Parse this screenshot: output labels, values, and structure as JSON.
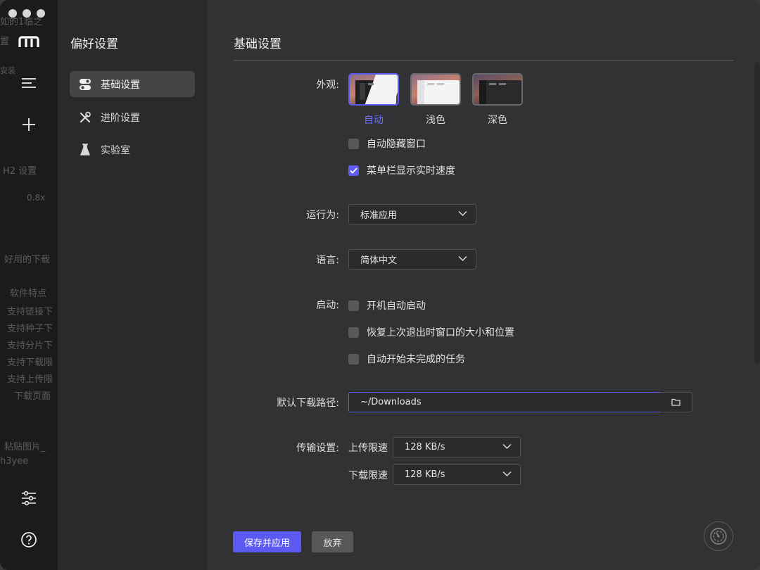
{
  "sidebar": {
    "title": "偏好设置",
    "items": [
      {
        "label": "基础设置",
        "active": true
      },
      {
        "label": "进阶设置",
        "active": false
      },
      {
        "label": "实验室",
        "active": false
      }
    ]
  },
  "main": {
    "title": "基础设置",
    "appearance": {
      "label": "外观:",
      "themes": [
        {
          "name": "自动",
          "selected": true
        },
        {
          "name": "浅色",
          "selected": false
        },
        {
          "name": "深色",
          "selected": false
        }
      ],
      "options": [
        {
          "label": "自动隐藏窗口",
          "checked": false
        },
        {
          "label": "菜单栏显示实时速度",
          "checked": true
        }
      ]
    },
    "run_as": {
      "label": "运行为:",
      "value": "标准应用"
    },
    "language": {
      "label": "语言:",
      "value": "简体中文"
    },
    "startup": {
      "label": "启动:",
      "options": [
        {
          "label": "开机自动启动",
          "checked": false
        },
        {
          "label": "恢复上次退出时窗口的大小和位置",
          "checked": false
        },
        {
          "label": "自动开始未完成的任务",
          "checked": false
        }
      ]
    },
    "download_path": {
      "label": "默认下载路径:",
      "value": "~/Downloads"
    },
    "transfer": {
      "label": "传输设置:",
      "upload": {
        "label": "上传限速",
        "value": "128 KB/s"
      },
      "download": {
        "label": "下载限速",
        "value": "128 KB/s"
      }
    },
    "buttons": {
      "save": "保存并应用",
      "discard": "放弃"
    }
  },
  "background_ghost_text": [
    "如的1临之",
    "置",
    "安装",
    "H2 设置",
    "0.8x",
    "好用的下载",
    "软件特点",
    "支持链接下",
    "支持种子下",
    "支持分片下",
    "支持下载限",
    "支持上传限",
    "下载页面",
    "粘贴图片_",
    "h3yee"
  ],
  "colors": {
    "accent": "#5a5af0",
    "window_bg": "#2f2f31",
    "rail_bg": "#1b1b1c"
  }
}
